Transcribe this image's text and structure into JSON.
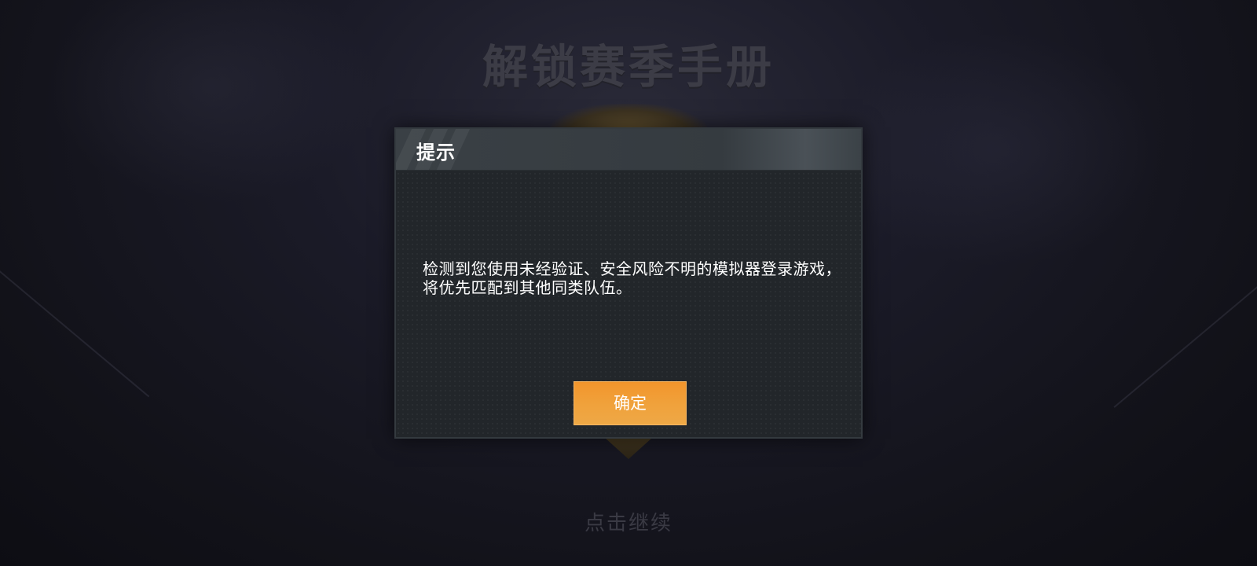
{
  "background": {
    "title": "解锁赛季手册",
    "subtitle": "点击继续"
  },
  "dialog": {
    "title": "提示",
    "message": "检测到您使用未经验证、安全风险不明的模拟器登录游戏，将优先匹配到其他同类队伍。",
    "confirm_label": "确定"
  },
  "colors": {
    "confirm_button": "#f2952c",
    "dialog_background": "#22262a",
    "header_background": "#3a4045"
  }
}
